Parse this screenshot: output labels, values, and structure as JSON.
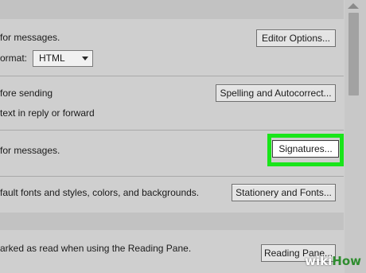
{
  "compose": {
    "editor_desc": "for messages.",
    "compose_format_label": "ormat:",
    "compose_format_value": "HTML",
    "editor_options_button": "Editor Options...",
    "spelling_desc": "fore sending",
    "reply_desc": "text in reply or forward",
    "spelling_button": "Spelling and Autocorrect..."
  },
  "signatures": {
    "desc": "for messages.",
    "button": "Signatures..."
  },
  "stationery": {
    "desc": "fault fonts and styles, colors, and backgrounds.",
    "button": "Stationery and Fonts..."
  },
  "reading_pane": {
    "desc": "arked as read when using the Reading Pane.",
    "button": "Reading Pane..."
  },
  "highlight_color": "#19e51a",
  "watermark": {
    "part1": "wiki",
    "part2": "How"
  }
}
